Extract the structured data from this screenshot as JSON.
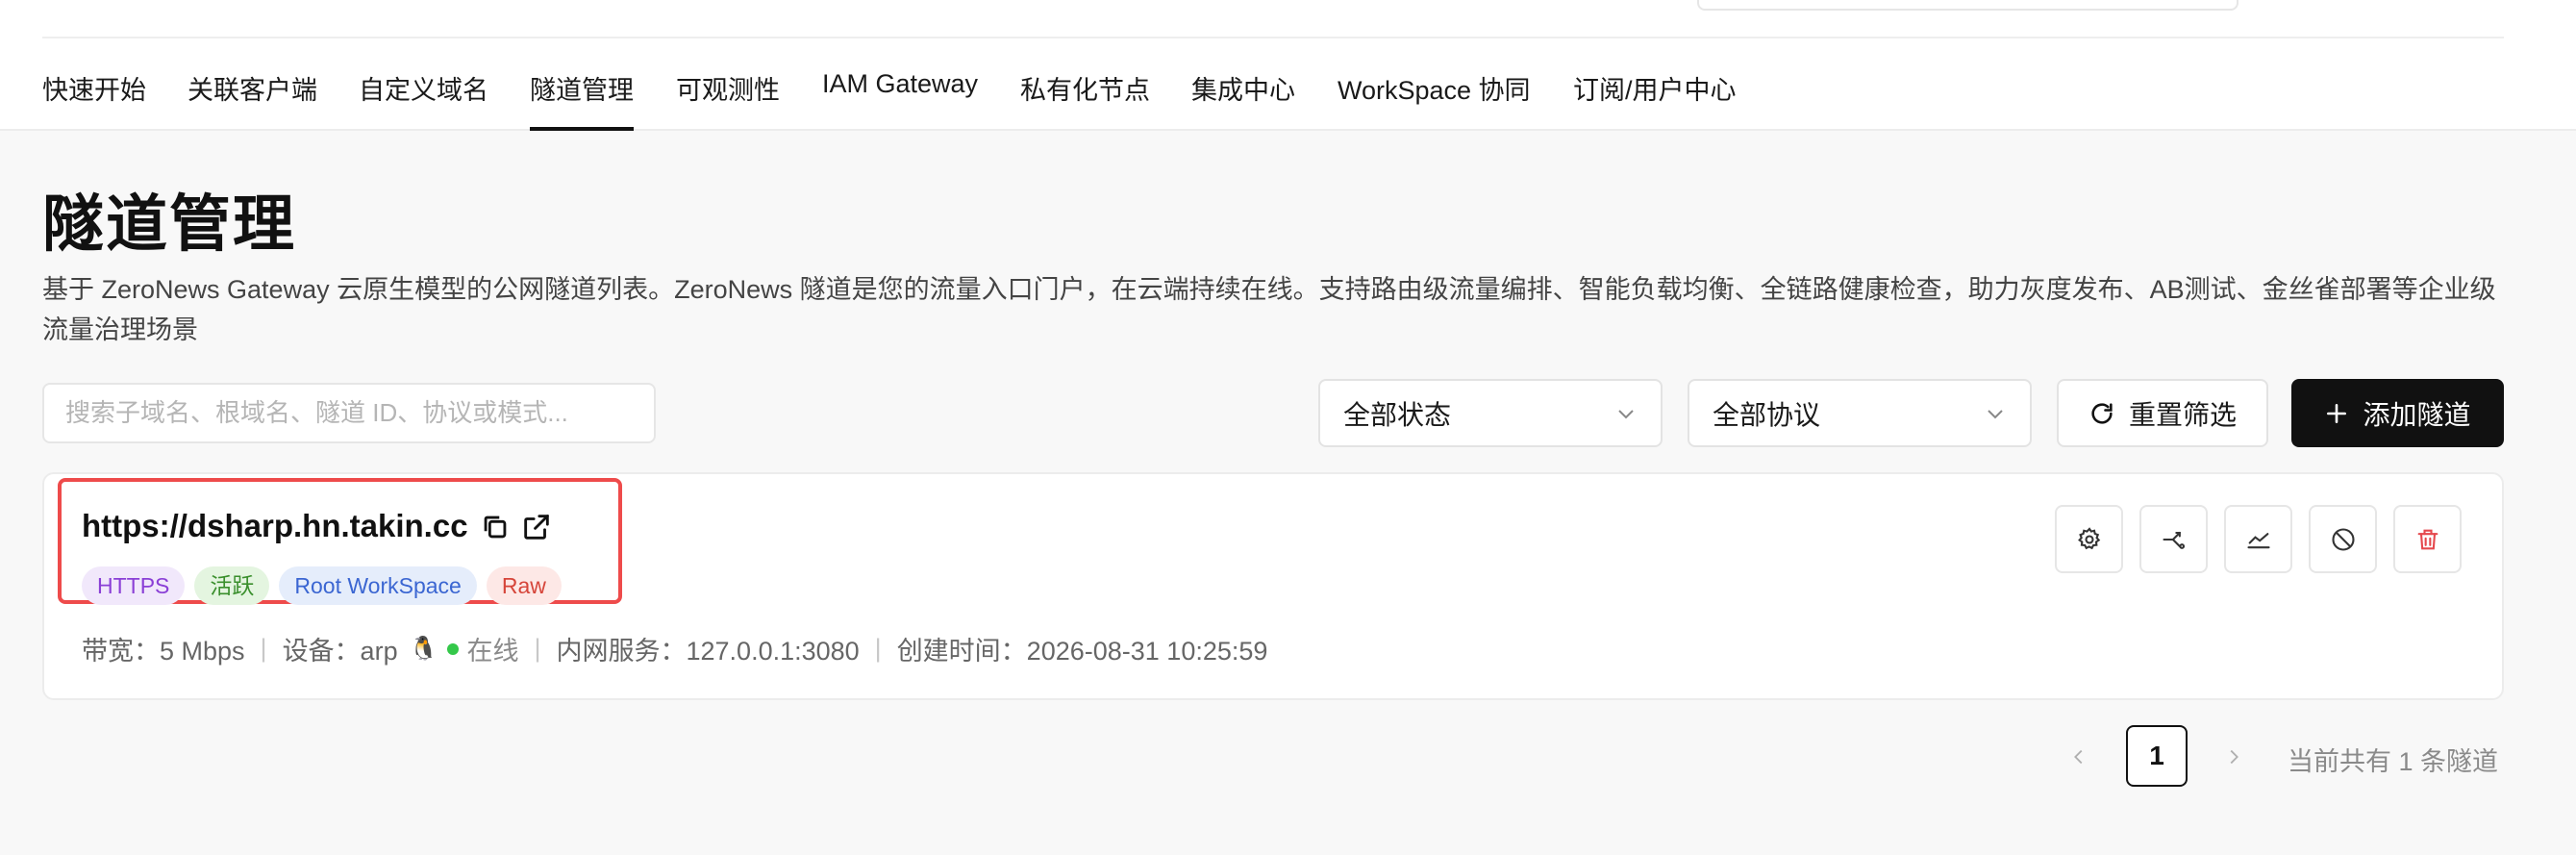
{
  "nav": {
    "items": [
      {
        "label": "快速开始",
        "active": false
      },
      {
        "label": "关联客户端",
        "active": false
      },
      {
        "label": "自定义域名",
        "active": false
      },
      {
        "label": "隧道管理",
        "active": true
      },
      {
        "label": "可观测性",
        "active": false
      },
      {
        "label": "IAM Gateway",
        "active": false
      },
      {
        "label": "私有化节点",
        "active": false
      },
      {
        "label": "集成中心",
        "active": false
      },
      {
        "label": "WorkSpace 协同",
        "active": false
      },
      {
        "label": "订阅/用户中心",
        "active": false
      }
    ]
  },
  "page": {
    "title": "隧道管理",
    "description": "基于 ZeroNews Gateway 云原生模型的公网隧道列表。ZeroNews 隧道是您的流量入口门户，在云端持续在线。支持路由级流量编排、智能负载均衡、全链路健康检查，助力灰度发布、AB测试、金丝雀部署等企业级流量治理场景"
  },
  "filters": {
    "search_placeholder": "搜索子域名、根域名、隧道 ID、协议或模式...",
    "status_value": "全部状态",
    "protocol_value": "全部协议",
    "reset_label": "重置筛选",
    "add_label": "添加隧道"
  },
  "tunnel": {
    "url": "https://dsharp.hn.takin.cc",
    "tags": {
      "protocol": "HTTPS",
      "status": "活跃",
      "workspace": "Root WorkSpace",
      "mode": "Raw"
    },
    "meta": {
      "bandwidth": "带宽：5 Mbps",
      "device": "设备：arp",
      "online": "在线",
      "service": "内网服务：127.0.0.1:3080",
      "created": "创建时间：2026-08-31 10:25:59"
    },
    "actions": [
      "gear-icon",
      "share-icon",
      "chart-icon",
      "ban-icon",
      "trash-icon"
    ]
  },
  "pagination": {
    "current_page": "1",
    "total_text": "当前共有 1 条隧道"
  },
  "colors": {
    "accent": "#111111",
    "highlight": "#ee4b4b",
    "online": "#34c84a",
    "danger": "#e5484d"
  }
}
